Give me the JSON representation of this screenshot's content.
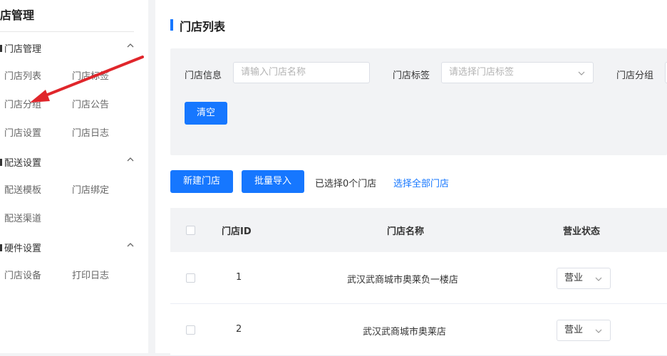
{
  "sidebar": {
    "title": "店管理",
    "groups": [
      {
        "label": "门店管理",
        "items": [
          "门店列表",
          "门店标签",
          "门店分组",
          "门店公告",
          "门店设置",
          "门店日志"
        ]
      },
      {
        "label": "配送设置",
        "items": [
          "配送模板",
          "门店绑定",
          "配送渠道"
        ]
      },
      {
        "label": "硬件设置",
        "items": [
          "门店设备",
          "打印日志"
        ]
      }
    ]
  },
  "page": {
    "title": "门店列表"
  },
  "filters": {
    "store_info_label": "门店信息",
    "store_info_placeholder": "请输入门店名称",
    "store_tag_label": "门店标签",
    "store_tag_placeholder": "请选择门店标签",
    "store_group_label": "门店分组",
    "clear_button": "清空"
  },
  "toolbar": {
    "new_store": "新建门店",
    "bulk_import": "批量导入",
    "selected_text": "已选择0个门店",
    "select_all_link": "选择全部门店"
  },
  "table": {
    "columns": [
      "门店ID",
      "门店名称",
      "营业状态"
    ],
    "rows": [
      {
        "id": "1",
        "name": "武汉武商城市奥莱负一楼店",
        "status": "营业"
      },
      {
        "id": "2",
        "name": "武汉武商城市奥莱店",
        "status": "营业"
      }
    ]
  },
  "colors": {
    "accent": "#1677ff",
    "annotation_arrow": "#e0262b"
  }
}
